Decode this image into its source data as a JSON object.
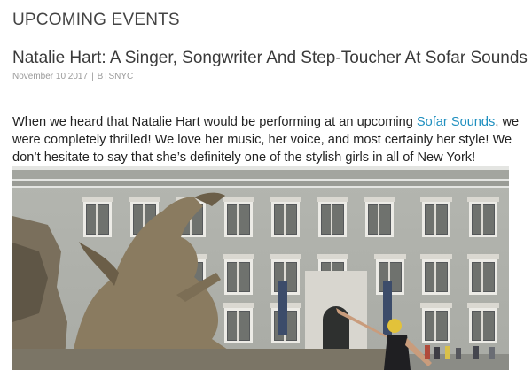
{
  "section": {
    "heading": "UPCOMING EVENTS"
  },
  "post": {
    "title": "Natalie Hart: A Singer, Songwriter And Step-Toucher At Sofar Sounds",
    "date": "November 10 2017",
    "separator": "|",
    "category": "BTSNYC",
    "intro_before_link": "When we heard that Natalie Hart would be performing at an upcoming ",
    "intro_link": "Sofar Sounds",
    "intro_after_link": ", we were completely thrilled! We love her music, her voice, and most certainly her style! We don’t hesitate to say that she’s definitely one of the stylish girls in all of New York!"
  },
  "colors": {
    "link": "#1f8fbf",
    "heading": "#444444",
    "meta": "#9a9a9a"
  }
}
